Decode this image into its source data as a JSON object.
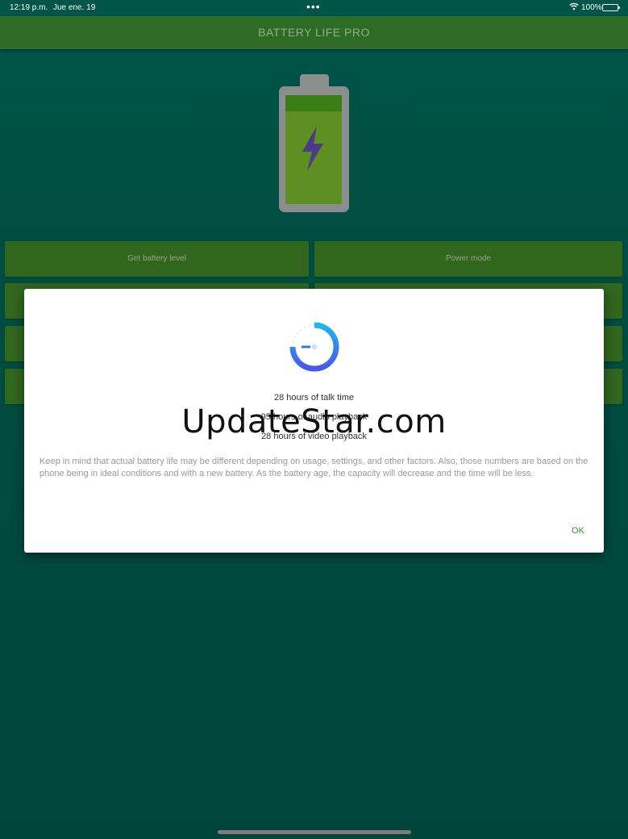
{
  "status_bar": {
    "time": "12:19 p.m.",
    "date": "Jue ene. 19",
    "dots": "•••",
    "battery_percent": "100%"
  },
  "app_bar": {
    "title": "BATTERY LIFE PRO"
  },
  "buttons": {
    "get_battery_level": "Get battery level",
    "power_mode": "Power mode"
  },
  "dialog": {
    "lines": [
      "28 hours of talk time",
      "95 hours of audio playback",
      "28 hours of video playback"
    ],
    "note": "Keep in mind that actual battery life may be different depending on usage, settings, and other factors. Also, those numbers are based on the phone being in ideal conditions and with a new battery. As the battery age, the capacity will decrease and the time will be less.",
    "ok_label": "OK"
  },
  "watermark": "UpdateStar.com",
  "icons": {
    "battery": "battery-charging-icon",
    "spinner": "loading-spinner-icon",
    "wifi": "wifi-icon"
  },
  "colors": {
    "background": "#004d40",
    "app_bar": "#2e6b24",
    "button": "#31661f",
    "ok_text": "#3a8d2c",
    "spinner_start": "#1eb6f0",
    "spinner_end": "#4a57e8"
  }
}
